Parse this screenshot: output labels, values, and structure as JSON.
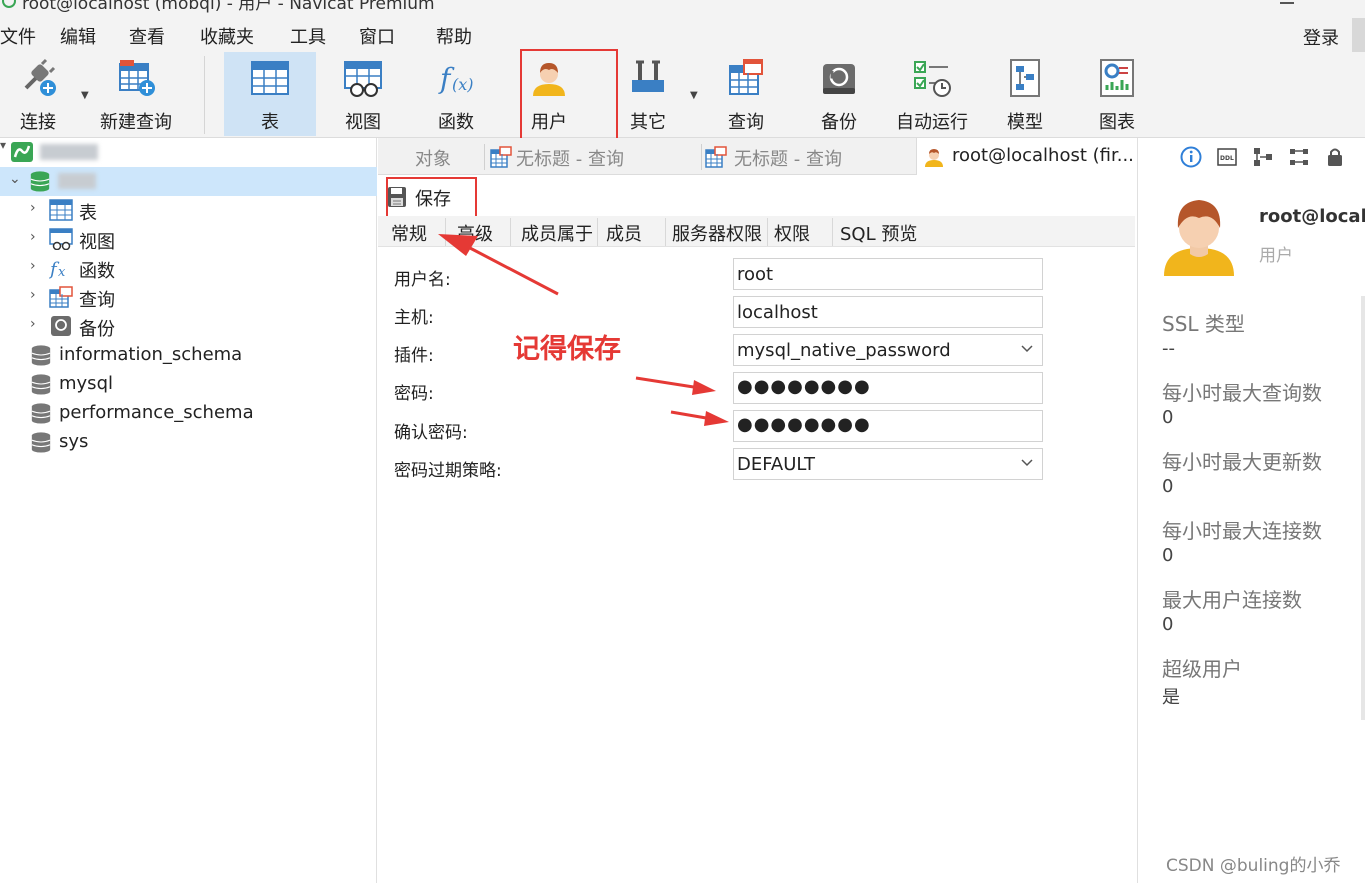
{
  "window": {
    "title": "root@localhost (mobqi) - 用户 - Navicat Premium"
  },
  "menu": [
    "文件",
    "编辑",
    "查看",
    "收藏夹",
    "工具",
    "窗口",
    "帮助"
  ],
  "login_label": "登录",
  "toolbar": {
    "connect": "连接",
    "new_query": "新建查询",
    "table": "表",
    "view": "视图",
    "function": "函数",
    "user": "用户",
    "other": "其它",
    "query": "查询",
    "backup": "备份",
    "automation": "自动运行",
    "model": "模型",
    "chart": "图表"
  },
  "tree": {
    "children": [
      "表",
      "视图",
      "函数",
      "查询",
      "备份"
    ],
    "databases": [
      "information_schema",
      "mysql",
      "performance_schema",
      "sys"
    ]
  },
  "tabs": {
    "objects": "对象",
    "query1": "无标题 - 查询",
    "query2": "无标题 - 查询",
    "active": "root@localhost (fir..."
  },
  "save_label": "保存",
  "subtabs": [
    "常规",
    "高级",
    "成员属于",
    "成员",
    "服务器权限",
    "权限",
    "SQL 预览"
  ],
  "form": {
    "username_label": "用户名:",
    "username_value": "root",
    "host_label": "主机:",
    "host_value": "localhost",
    "plugin_label": "插件:",
    "plugin_value": "mysql_native_password",
    "password_label": "密码:",
    "password_value": "●●●●●●●●",
    "confirm_label": "确认密码:",
    "confirm_value": "●●●●●●●●",
    "expire_label": "密码过期策略:",
    "expire_value": "DEFAULT"
  },
  "annotation": "记得保存",
  "info": {
    "name": "root@local.",
    "role": "用户",
    "fields": [
      {
        "k": "SSL 类型",
        "v": "--"
      },
      {
        "k": "每小时最大查询数",
        "v": "0"
      },
      {
        "k": "每小时最大更新数",
        "v": "0"
      },
      {
        "k": "每小时最大连接数",
        "v": "0"
      },
      {
        "k": "最大用户连接数",
        "v": "0"
      },
      {
        "k": "超级用户",
        "v": "是"
      }
    ]
  },
  "watermark": "CSDN @buling的小乔",
  "colors": {
    "accent": "#e53935",
    "selected": "#cde6fb",
    "active_tool": "#cfe3f5"
  }
}
